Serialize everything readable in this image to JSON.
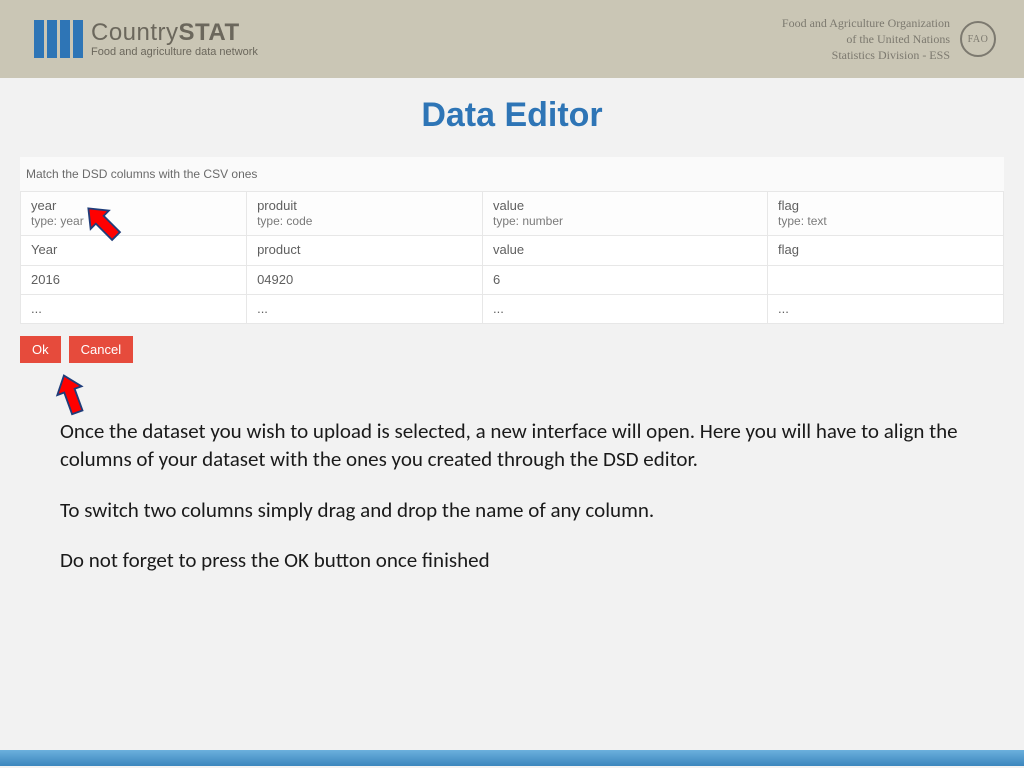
{
  "header": {
    "brand_main": "Country",
    "brand_bold": "STAT",
    "tagline": "Food and agriculture data network",
    "fao_line1": "Food and Agriculture Organization",
    "fao_line2": "of the United Nations",
    "fao_line3": "Statistics Division - ESS",
    "seal": "FAO"
  },
  "title": "Data Editor",
  "instruction": "Match the DSD columns with the CSV ones",
  "dsd_cols": [
    {
      "name": "year",
      "type": "type: year"
    },
    {
      "name": "produit",
      "type": "type: code"
    },
    {
      "name": "value",
      "type": "type: number"
    },
    {
      "name": "flag",
      "type": "type: text"
    }
  ],
  "csv_header": [
    "Year",
    "product",
    "value",
    "flag"
  ],
  "csv_rows": [
    [
      "2016",
      "04920",
      "6",
      ""
    ],
    [
      "...",
      "...",
      "...",
      "..."
    ]
  ],
  "buttons": {
    "ok": "Ok",
    "cancel": "Cancel"
  },
  "copy": {
    "p1": "Once the dataset you wish to upload is selected, a new interface will open. Here you will have to align the columns of your dataset with the ones you created through the DSD editor.",
    "p2": "To switch two columns simply drag and drop the name of any column.",
    "p3": "Do not forget to press the OK button once finished"
  }
}
